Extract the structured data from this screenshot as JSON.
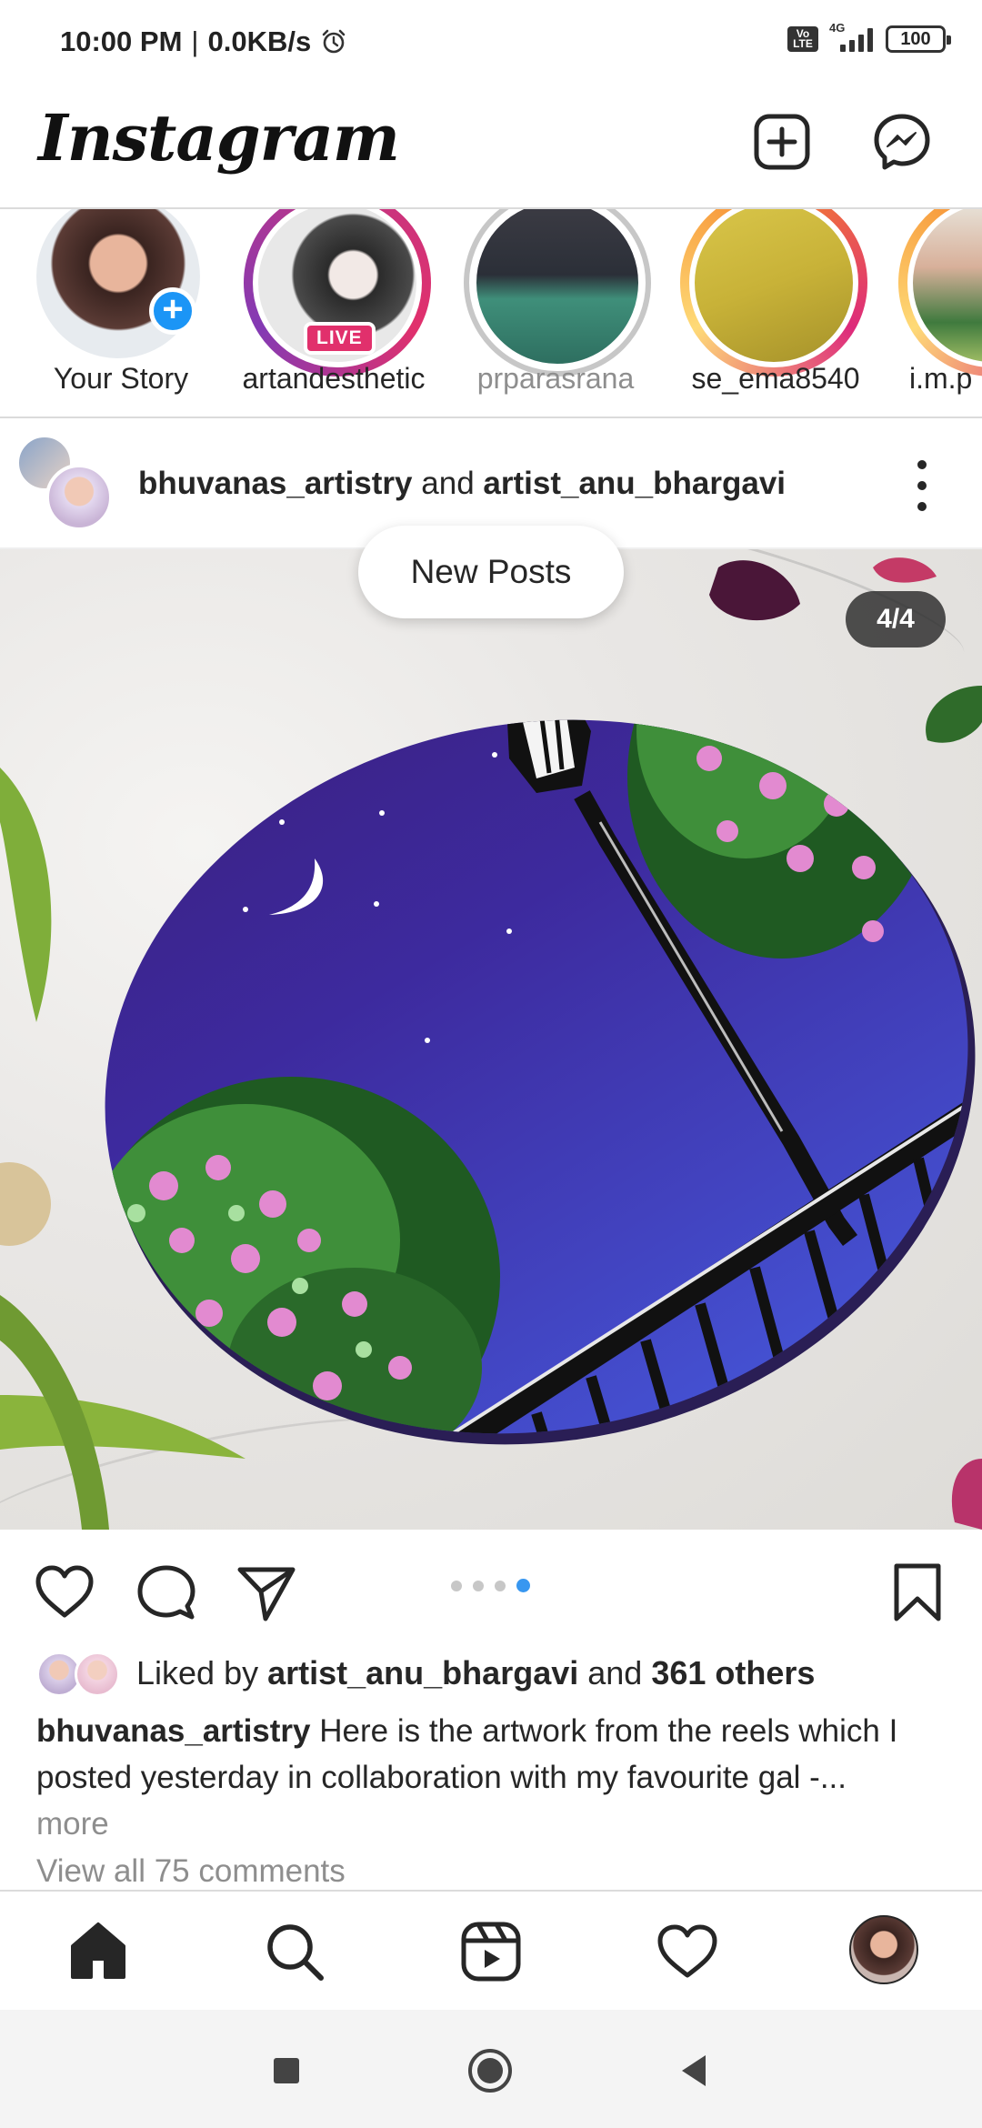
{
  "status_bar": {
    "time": "10:00 PM",
    "separator": "|",
    "speed": "0.0KB/s",
    "volte": "Vo LTE",
    "network": "4G",
    "battery": "100"
  },
  "header": {
    "logo": "Instagram",
    "icons": [
      "new-post-icon",
      "messenger-icon"
    ]
  },
  "stories": [
    {
      "name": "Your Story",
      "ring": "none",
      "add_badge": "+"
    },
    {
      "name": "artandesthetic",
      "ring": "live",
      "badge": "LIVE"
    },
    {
      "name": "prparasrana",
      "ring": "seen"
    },
    {
      "name": "se_ema8540",
      "ring": "gradient"
    },
    {
      "name": "i.m.p",
      "ring": "gradient"
    }
  ],
  "post": {
    "user1": "bhuvanas_artistry",
    "connector": "and",
    "user2": "artist_anu_bhargavi",
    "slide_counter": "4/4",
    "new_posts": "New Posts",
    "carousel": {
      "total": 4,
      "active": 4
    },
    "likes": {
      "prefix": "Liked by",
      "user": "artist_anu_bhargavi",
      "connector": "and",
      "others": "361 others"
    },
    "caption": {
      "user": "bhuvanas_artistry",
      "text": "Here is the artwork from the reels which I posted yesterday in collaboration with my favourite gal -...",
      "more": "more"
    },
    "comments_link": "View all 75 comments"
  },
  "bottom_nav": [
    "home-icon",
    "search-icon",
    "reels-icon",
    "activity-heart-icon",
    "profile-avatar"
  ],
  "system_nav": [
    "recents-button",
    "home-button",
    "back-button"
  ],
  "colors": {
    "accent_blue": "#3897f0",
    "live_pink": "#e1306c",
    "text": "#262626",
    "muted": "#8e8e8e"
  }
}
